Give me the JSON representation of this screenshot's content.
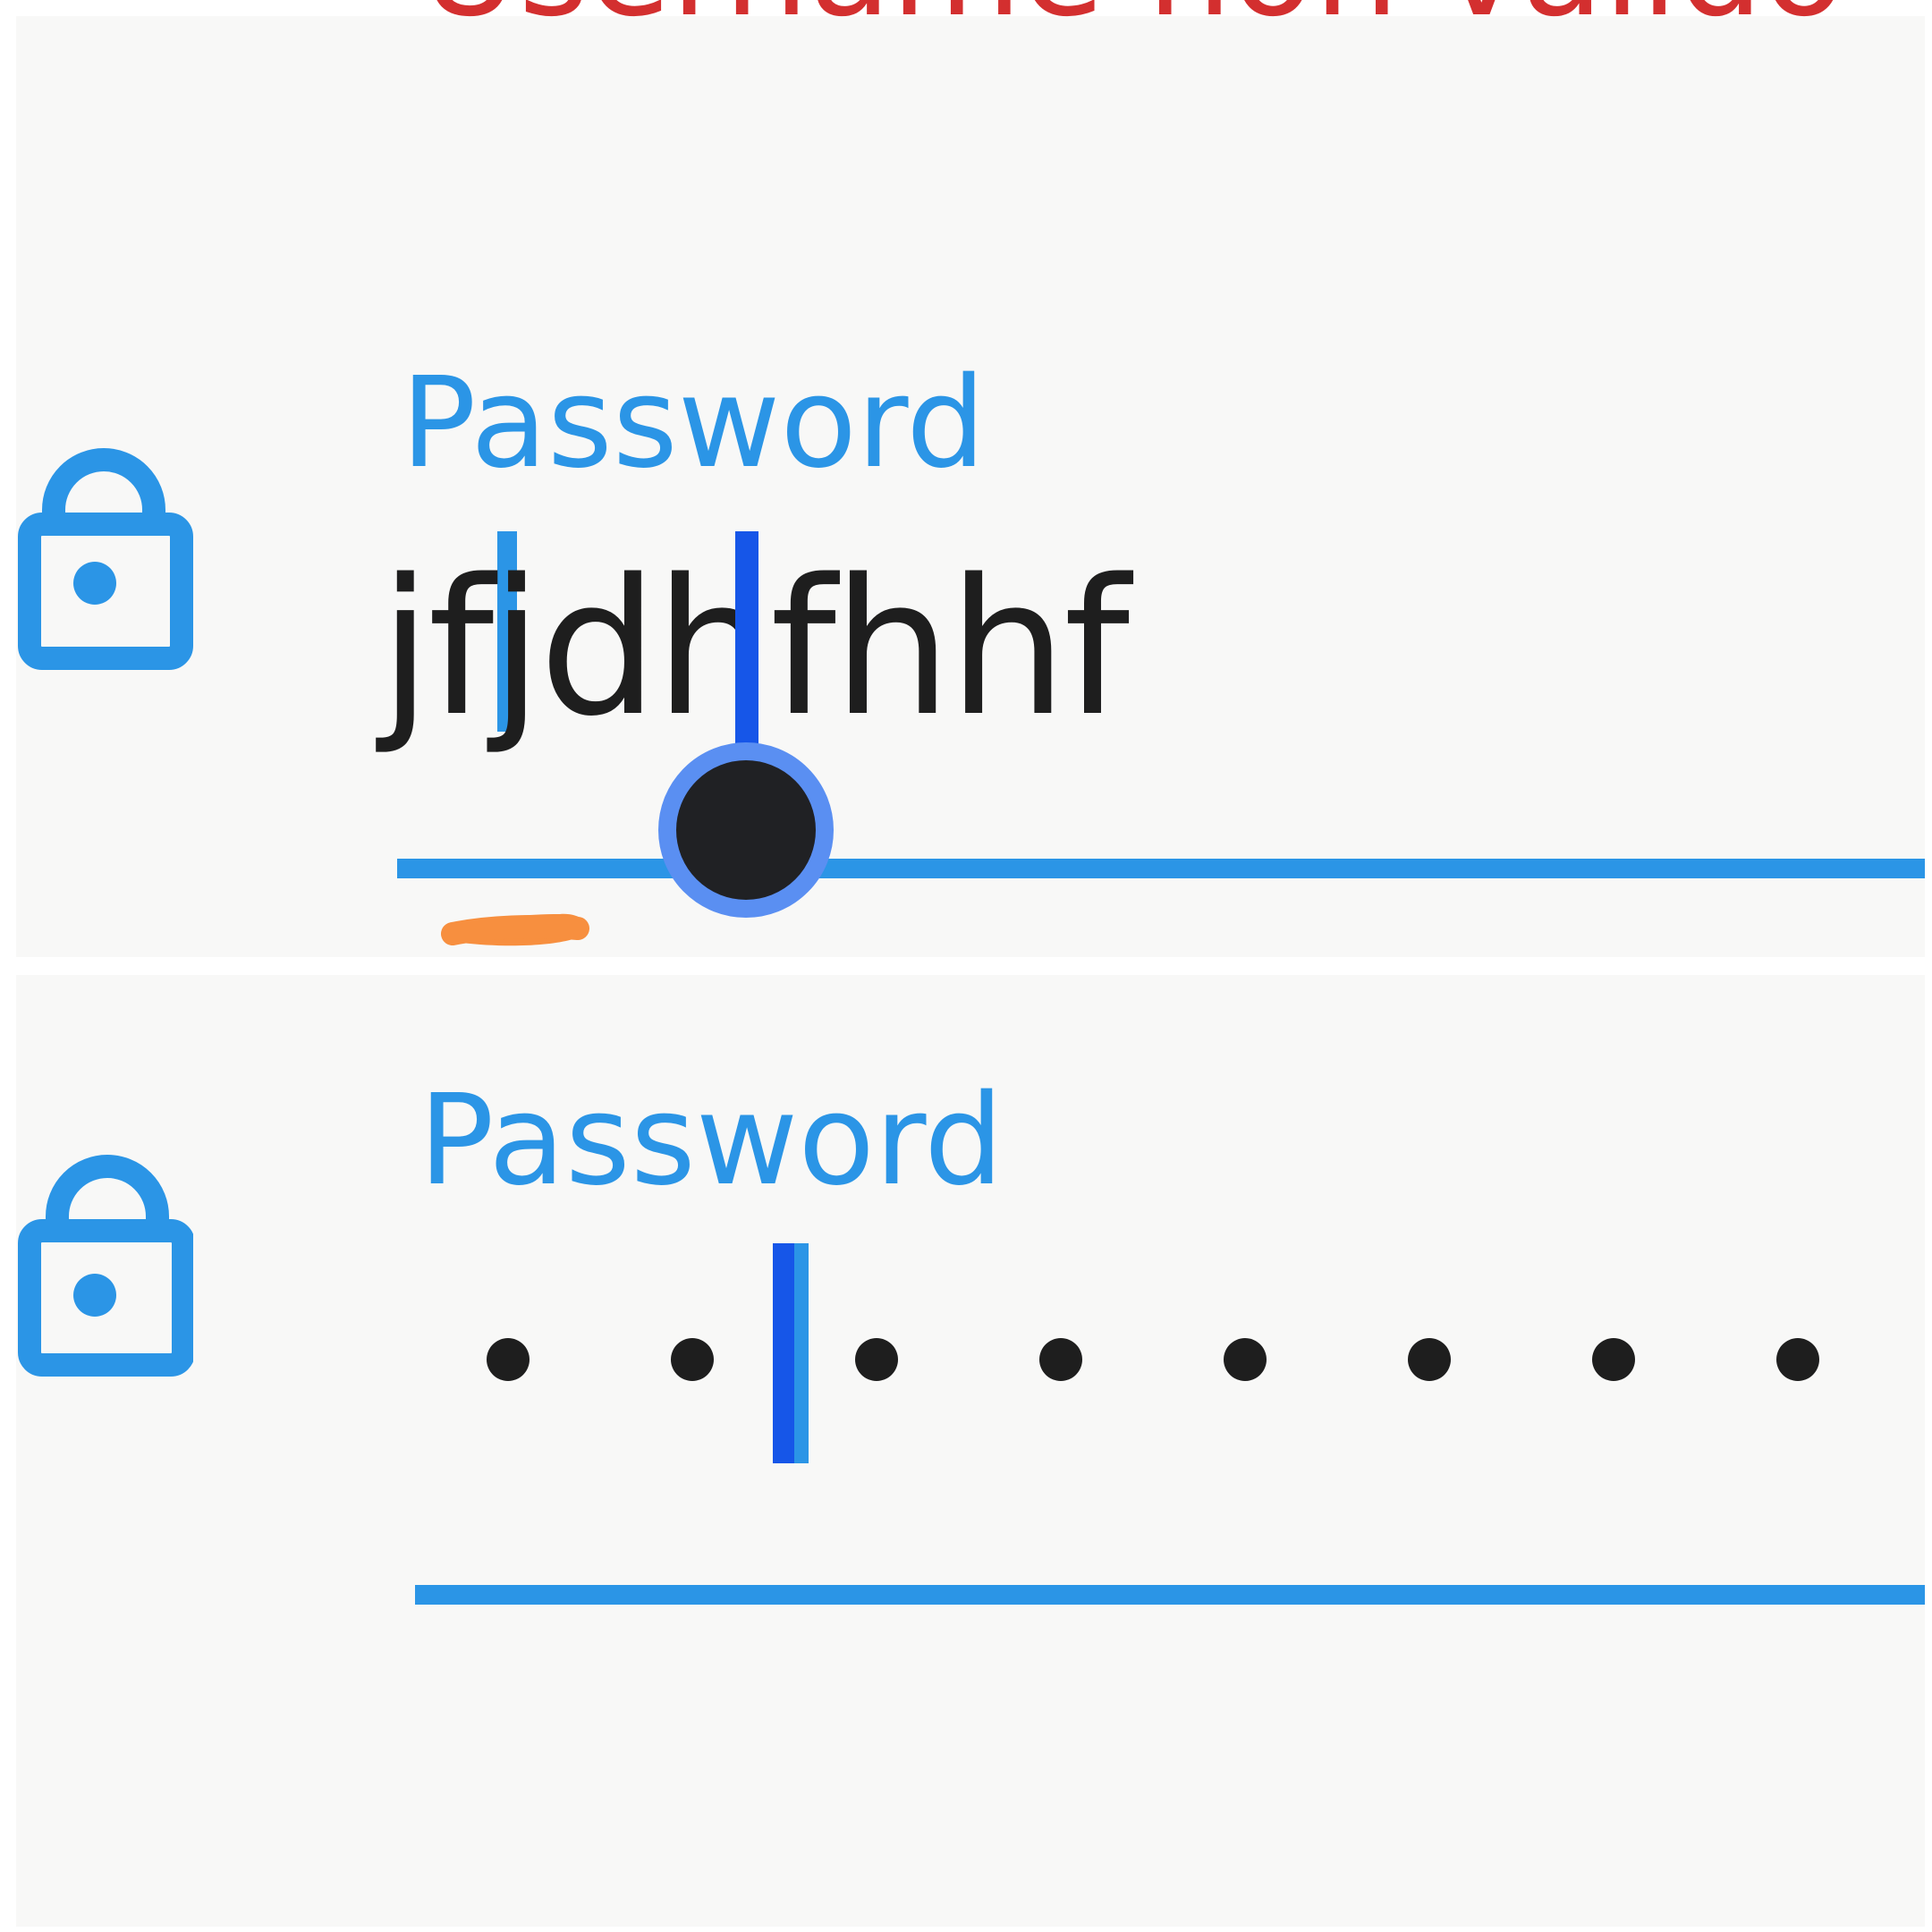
{
  "colors": {
    "accent": "#2b95e6",
    "error": "#d32f2f",
    "selection_handle": "#5a8ff2",
    "text": "#1e1e1e",
    "background": "#f8f8f7",
    "scribble": "#f78f3f"
  },
  "username_field": {
    "error_message": "Username non valido"
  },
  "password_field_top": {
    "icon": "lock-icon",
    "label": "Password",
    "value": "jfjdhfhhf"
  },
  "password_field_bottom": {
    "icon": "lock-icon",
    "label": "Password"
  }
}
